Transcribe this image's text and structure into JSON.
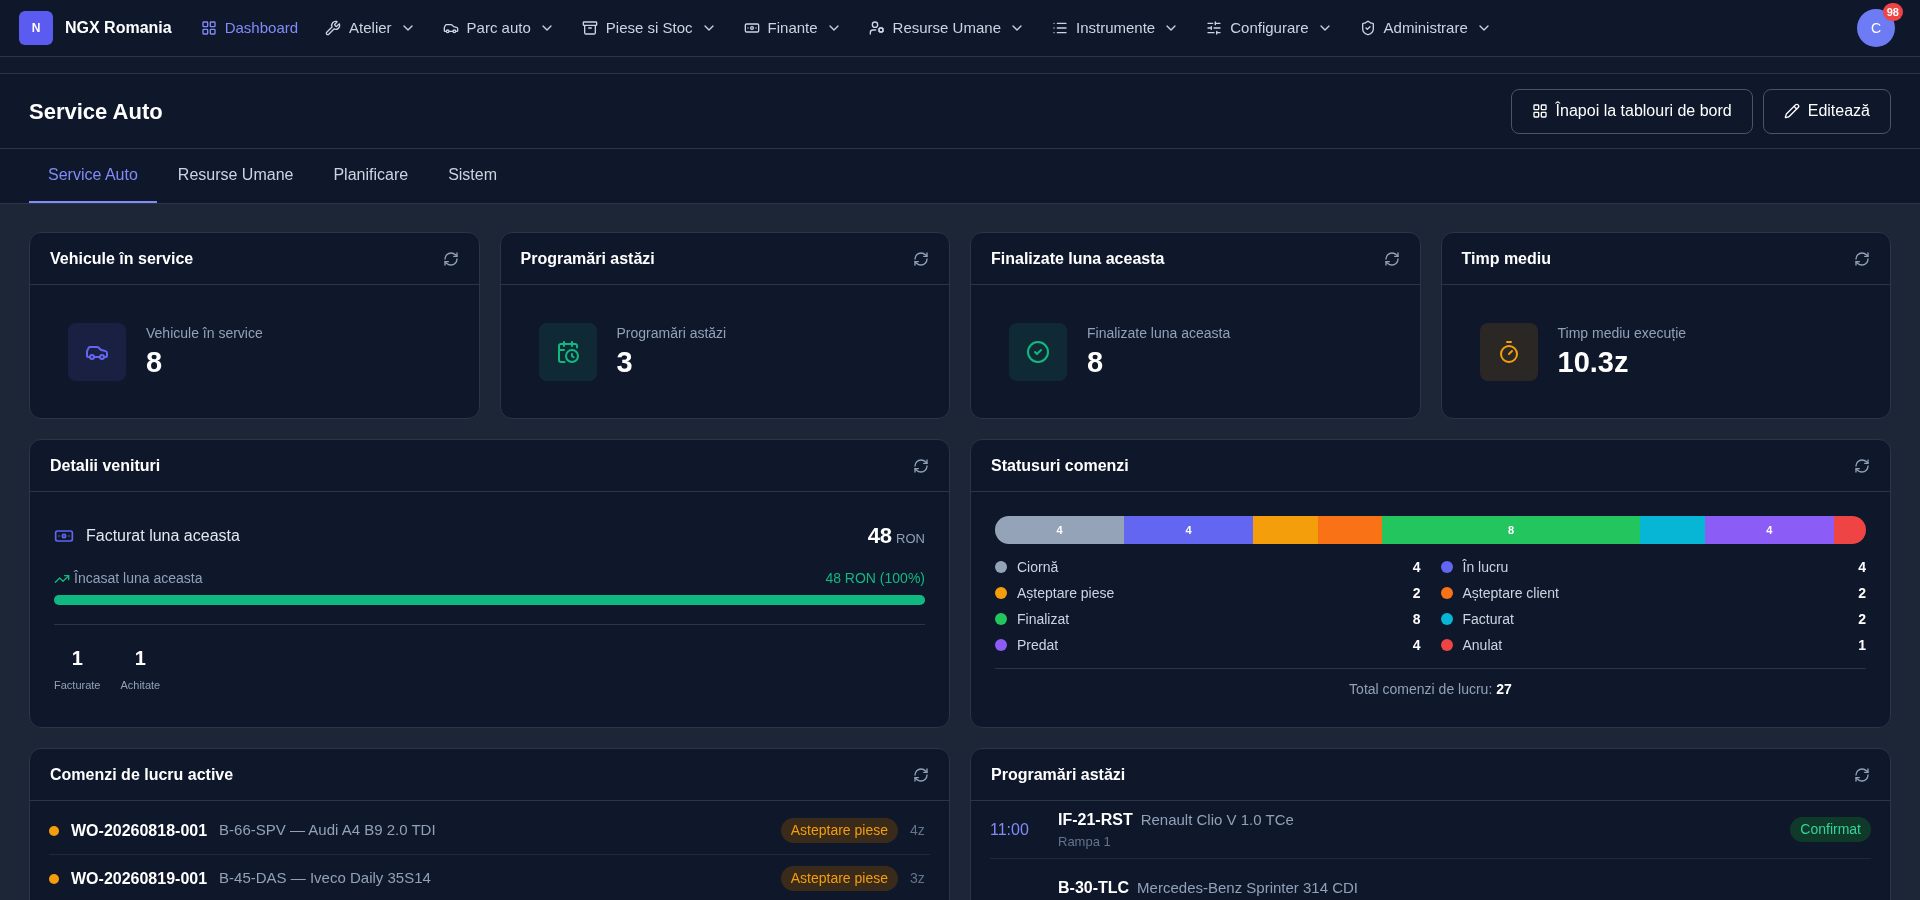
{
  "nav": {
    "logo": "N",
    "brand": "NGX Romania",
    "items": [
      {
        "kind": "grid",
        "label": "Dashboard",
        "selected": true,
        "menu": false
      },
      {
        "kind": "wrench",
        "label": "Atelier",
        "selected": false,
        "menu": true
      },
      {
        "kind": "car",
        "label": "Parc auto",
        "selected": false,
        "menu": true
      },
      {
        "kind": "archive",
        "label": "Piese si Stoc",
        "selected": false,
        "menu": true
      },
      {
        "kind": "money",
        "label": "Finante",
        "selected": false,
        "menu": true
      },
      {
        "kind": "users",
        "label": "Resurse Umane",
        "selected": false,
        "menu": true
      },
      {
        "kind": "list",
        "label": "Instrumente",
        "selected": false,
        "menu": true
      },
      {
        "kind": "sliders",
        "label": "Configurare",
        "selected": false,
        "menu": true
      },
      {
        "kind": "shield",
        "label": "Administrare",
        "selected": false,
        "menu": true
      }
    ],
    "avatar": "C",
    "badge": "98"
  },
  "header": {
    "title": "Service Auto",
    "buttons": [
      {
        "kind": "dashboards",
        "label": "Înapoi la tablouri de bord"
      },
      {
        "kind": "edit",
        "label": "Editează"
      }
    ]
  },
  "tabs": [
    {
      "label": "Service Auto",
      "selected": true
    },
    {
      "label": "Resurse Umane",
      "selected": false
    },
    {
      "label": "Planificare",
      "selected": false
    },
    {
      "label": "Sistem",
      "selected": false
    }
  ],
  "stat_cards": [
    {
      "title": "Vehicule în service",
      "kind": "vehicle",
      "color": "#6366f1",
      "label": "Vehicule în service",
      "value": "8"
    },
    {
      "title": "Programări astăzi",
      "kind": "calendar",
      "color": "#10b981",
      "label": "Programări astăzi",
      "value": "3"
    },
    {
      "title": "Finalizate luna aceasta",
      "kind": "check",
      "color": "#10b981",
      "label": "Finalizate luna aceasta",
      "value": "8"
    },
    {
      "title": "Timp mediu",
      "kind": "timer",
      "color": "#f59e0b",
      "label": "Timp mediu execuție",
      "value": "10.3z"
    }
  ],
  "revenue": {
    "title": "Detalii venituri",
    "invoiced_label": "Facturat luna aceasta",
    "invoiced_value": "48",
    "invoiced_unit": "RON",
    "collected_label": "Încasat luna aceasta",
    "collected_value": "48 RON (100%)",
    "level": 1.0,
    "counts": [
      {
        "value": "1",
        "label": "Facturate"
      },
      {
        "value": "1",
        "label": "Achitate"
      }
    ]
  },
  "statuses": {
    "title": "Statusuri comenzi",
    "bar": [
      {
        "label": "4",
        "color": "#94a3b8"
      },
      {
        "label": "4",
        "color": "#6366f1"
      },
      {
        "color": "#f59e0b"
      },
      {
        "color": "#f97316"
      },
      {
        "label": "8",
        "color": "#22c55e"
      },
      {
        "color": "#06b6d4"
      },
      {
        "label": "4",
        "color": "#8b5cf6"
      },
      {
        "color": "#ef4444"
      }
    ],
    "legend": [
      {
        "name": "Ciornă",
        "count": "4",
        "color": "#94a3b8"
      },
      {
        "name": "În lucru",
        "count": "4",
        "color": "#6366f1"
      },
      {
        "name": "Așteptare piese",
        "count": "2",
        "color": "#f59e0b"
      },
      {
        "name": "Așteptare client",
        "count": "2",
        "color": "#f97316"
      },
      {
        "name": "Finalizat",
        "count": "8",
        "color": "#22c55e"
      },
      {
        "name": "Facturat",
        "count": "2",
        "color": "#06b6d4"
      },
      {
        "name": "Predat",
        "count": "4",
        "color": "#8b5cf6"
      },
      {
        "name": "Anulat",
        "count": "1",
        "color": "#ef4444"
      }
    ],
    "total_label": "Total comenzi de lucru:",
    "total_value": "27"
  },
  "work_orders": {
    "title": "Comenzi de lucru active",
    "rows": [
      {
        "code": "WO-20260818-001",
        "vehicle": "B-66-SPV — Audi A4 B9 2.0 TDI",
        "status": "Asteptare piese",
        "color": "#f59e0b",
        "age": "4z"
      },
      {
        "code": "WO-20260819-001",
        "vehicle": "B-45-DAS — Iveco Daily 35S14",
        "status": "Asteptare piese",
        "color": "#f59e0b",
        "age": "3z"
      }
    ]
  },
  "appointments": {
    "title": "Programări astăzi",
    "rows": [
      {
        "time": "11:00",
        "plate": "IF-21-RST",
        "vehicle": "Renault Clio V 1.0 TCe",
        "location": "Rampa 1",
        "status": "Confirmat"
      },
      {
        "plate": "B-30-TLC",
        "vehicle": "Mercedes-Benz Sprinter 314 CDI"
      }
    ]
  }
}
